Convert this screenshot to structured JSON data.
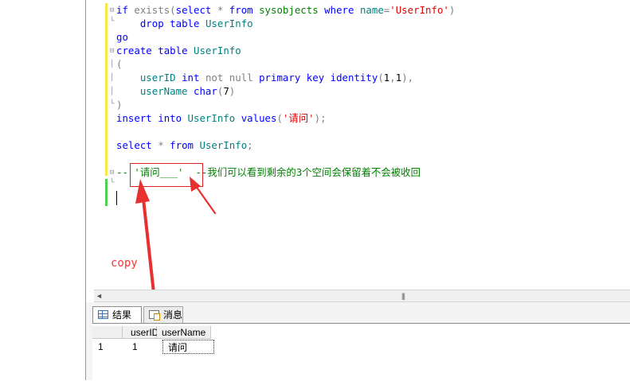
{
  "editor": {
    "lines": [
      [
        {
          "c": "kw",
          "t": "if"
        },
        {
          "c": "bl",
          "t": " "
        },
        {
          "c": "gr",
          "t": "exists("
        },
        {
          "c": "kw",
          "t": "select"
        },
        {
          "c": "bl",
          "t": " "
        },
        {
          "c": "gr",
          "t": "*"
        },
        {
          "c": "bl",
          "t": " "
        },
        {
          "c": "kw",
          "t": "from"
        },
        {
          "c": "bl",
          "t": " "
        },
        {
          "c": "cm",
          "t": "sysobjects"
        },
        {
          "c": "bl",
          "t": " "
        },
        {
          "c": "kw",
          "t": "where"
        },
        {
          "c": "bl",
          "t": " "
        },
        {
          "c": "ob",
          "t": "name"
        },
        {
          "c": "gr",
          "t": "="
        },
        {
          "c": "st",
          "t": "'UserInfo'"
        },
        {
          "c": "gr",
          "t": ")"
        }
      ],
      [
        {
          "c": "bl",
          "t": "    "
        },
        {
          "c": "kw",
          "t": "drop"
        },
        {
          "c": "bl",
          "t": " "
        },
        {
          "c": "kw",
          "t": "table"
        },
        {
          "c": "bl",
          "t": " "
        },
        {
          "c": "ob",
          "t": "UserInfo"
        }
      ],
      [
        {
          "c": "kw",
          "t": "go"
        }
      ],
      [
        {
          "c": "kw",
          "t": "create"
        },
        {
          "c": "bl",
          "t": " "
        },
        {
          "c": "kw",
          "t": "table"
        },
        {
          "c": "bl",
          "t": " "
        },
        {
          "c": "ob",
          "t": "UserInfo"
        }
      ],
      [
        {
          "c": "gr",
          "t": "("
        }
      ],
      [
        {
          "c": "bl",
          "t": "    "
        },
        {
          "c": "ob",
          "t": "userID"
        },
        {
          "c": "bl",
          "t": " "
        },
        {
          "c": "kw",
          "t": "int"
        },
        {
          "c": "bl",
          "t": " "
        },
        {
          "c": "gr",
          "t": "not null"
        },
        {
          "c": "bl",
          "t": " "
        },
        {
          "c": "kw",
          "t": "primary"
        },
        {
          "c": "bl",
          "t": " "
        },
        {
          "c": "kw",
          "t": "key"
        },
        {
          "c": "bl",
          "t": " "
        },
        {
          "c": "kw",
          "t": "identity"
        },
        {
          "c": "gr",
          "t": "("
        },
        {
          "c": "bl",
          "t": "1"
        },
        {
          "c": "gr",
          "t": ","
        },
        {
          "c": "bl",
          "t": "1"
        },
        {
          "c": "gr",
          "t": "),"
        }
      ],
      [
        {
          "c": "bl",
          "t": "    "
        },
        {
          "c": "ob",
          "t": "userName"
        },
        {
          "c": "bl",
          "t": " "
        },
        {
          "c": "kw",
          "t": "char"
        },
        {
          "c": "gr",
          "t": "("
        },
        {
          "c": "bl",
          "t": "7"
        },
        {
          "c": "gr",
          "t": ")"
        }
      ],
      [
        {
          "c": "gr",
          "t": ")"
        }
      ],
      [
        {
          "c": "kw",
          "t": "insert"
        },
        {
          "c": "bl",
          "t": " "
        },
        {
          "c": "kw",
          "t": "into"
        },
        {
          "c": "bl",
          "t": " "
        },
        {
          "c": "ob",
          "t": "UserInfo"
        },
        {
          "c": "bl",
          "t": " "
        },
        {
          "c": "kw",
          "t": "values"
        },
        {
          "c": "gr",
          "t": "("
        },
        {
          "c": "st",
          "t": "'请问'"
        },
        {
          "c": "gr",
          "t": ");"
        }
      ],
      [],
      [
        {
          "c": "kw",
          "t": "select"
        },
        {
          "c": "bl",
          "t": " "
        },
        {
          "c": "gr",
          "t": "*"
        },
        {
          "c": "bl",
          "t": " "
        },
        {
          "c": "kw",
          "t": "from"
        },
        {
          "c": "bl",
          "t": " "
        },
        {
          "c": "ob",
          "t": "UserInfo"
        },
        {
          "c": "gr",
          "t": ";"
        }
      ],
      [],
      [
        {
          "c": "cm",
          "t": "-- '请问___'  --我们可以看到剩余的3个空间会保留着不会被收回"
        }
      ],
      [],
      []
    ]
  },
  "annotation": {
    "copy_label": "copy",
    "arrow_color": "#e83030"
  },
  "results": {
    "tabs": [
      {
        "label": "结果",
        "icon": "grid-icon",
        "active": true
      },
      {
        "label": "消息",
        "icon": "messages-icon",
        "active": false
      }
    ],
    "columns": [
      "userID",
      "userName"
    ],
    "rows": [
      {
        "row_number": "1",
        "userID": "1",
        "userName": "请问"
      }
    ]
  },
  "scrollbar": {
    "left_arrow": "◄",
    "grip": "|||"
  },
  "colors": {
    "keyword": "#0000ff",
    "string": "#e00000",
    "comment": "#008000",
    "object": "#008080",
    "operator": "#808080",
    "annotation": "#e02020"
  }
}
